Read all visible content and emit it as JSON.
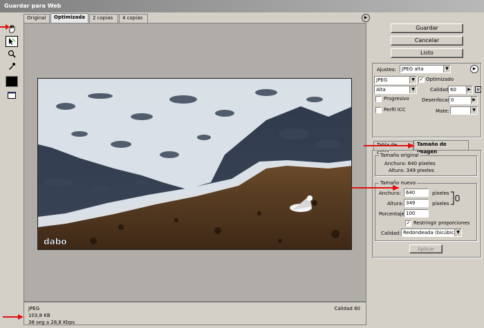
{
  "window": {
    "title": "Guardar para Web"
  },
  "tabs": [
    {
      "label": "Original"
    },
    {
      "label": "Optimizada"
    },
    {
      "label": "2 copias"
    },
    {
      "label": "4 copias"
    }
  ],
  "tools": {
    "hand": "hand-icon",
    "slice_select": "slice-select-icon",
    "zoom": "zoom-icon",
    "eyedropper": "eyedropper-icon",
    "color_swatch": "#000000",
    "preview": "browser-preview-icon"
  },
  "image": {
    "watermark": "dabo"
  },
  "status": {
    "format": "JPEG",
    "size": "103,8 KB",
    "time": "38 seg a 28,8 Kbps",
    "quality": "Calidad 60"
  },
  "buttons": {
    "save": "Guardar",
    "cancel": "Cancelar",
    "done": "Listo"
  },
  "settings": {
    "preset_label": "Ajustes:",
    "preset_value": "JPEG alta",
    "format": "JPEG",
    "optimized_label": "Optimizado",
    "optimized_checked": true,
    "quality_level": "Alta",
    "quality_label": "Calidad:",
    "quality_value": "60",
    "progressive_label": "Progresivo",
    "blur_label": "Desenfocar:",
    "blur_value": "0",
    "icc_label": "Perfil ICC",
    "matte_label": "Mate:",
    "matte_value": ""
  },
  "panel_tabs": {
    "tab1": "Tabla de color",
    "tab2": "Tamaño de imagen"
  },
  "original_size": {
    "title": "Tamaño original",
    "width": "Anchura: 640 píxeles",
    "height": "Altura: 349 píxeles"
  },
  "new_size": {
    "title": "Tamaño nuevo",
    "width_label": "Anchura:",
    "width_value": "640",
    "width_unit": "píxeles",
    "height_label": "Altura:",
    "height_value": "349",
    "height_unit": "píxeles",
    "percent_label": "Porcentaje:",
    "percent_value": "100",
    "constrain_label": "Restringir proporciones",
    "constrain_checked": true,
    "quality_label": "Calidad:",
    "quality_value": "Redondeada (bicúbica)",
    "apply": "Aplicar"
  },
  "annotation_color": "#e01010"
}
